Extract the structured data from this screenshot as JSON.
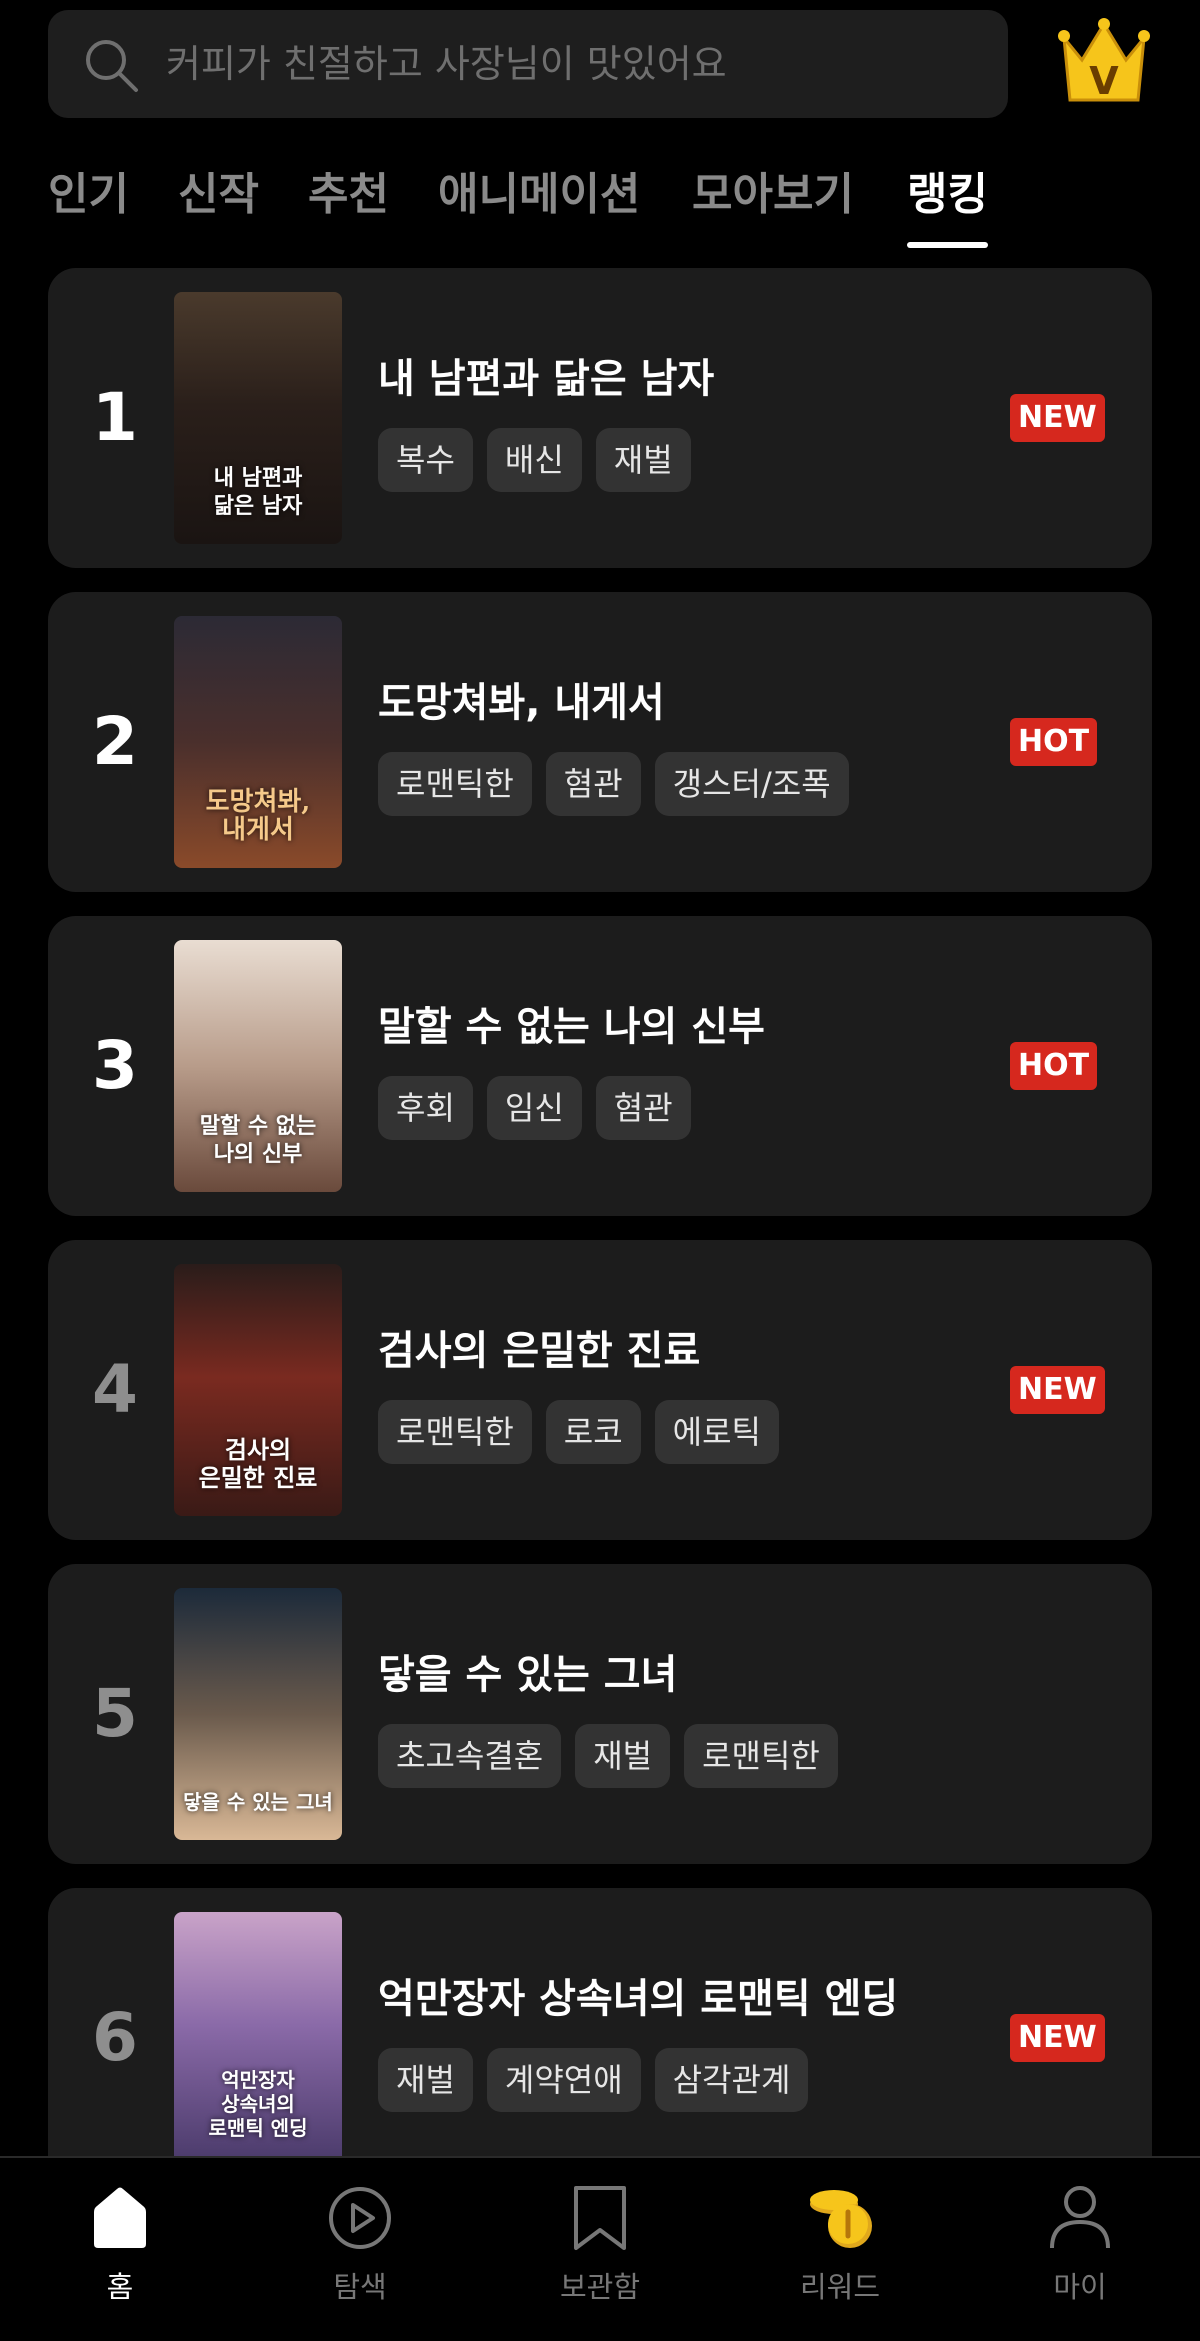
{
  "search": {
    "placeholder": "커피가 친절하고 사장님이 맛있어요",
    "crown_letter": "V"
  },
  "tabs": [
    {
      "label": "인기"
    },
    {
      "label": "신작"
    },
    {
      "label": "추천"
    },
    {
      "label": "애니메이션"
    },
    {
      "label": "모아보기"
    },
    {
      "label": "랭킹",
      "active": true
    }
  ],
  "ranking": [
    {
      "rank": "1",
      "title": "내 남편과 닮은 남자",
      "tags": [
        "복수",
        "배신",
        "재벌"
      ],
      "badge": "NEW",
      "cover_text": "내 남편과\n닮은 남자"
    },
    {
      "rank": "2",
      "title": "도망쳐봐, 내게서",
      "tags": [
        "로맨틱한",
        "혐관",
        "갱스터/조폭"
      ],
      "badge": "HOT",
      "cover_text": "도망쳐봐,\n내게서"
    },
    {
      "rank": "3",
      "title": "말할 수 없는 나의 신부",
      "tags": [
        "후회",
        "임신",
        "혐관"
      ],
      "badge": "HOT",
      "cover_text": "말할 수 없는\n나의 신부"
    },
    {
      "rank": "4",
      "title": "검사의 은밀한 진료",
      "tags": [
        "로맨틱한",
        "로코",
        "에로틱"
      ],
      "badge": "NEW",
      "cover_text": "검사의\n은밀한 진료"
    },
    {
      "rank": "5",
      "title": "닿을 수 있는 그녀",
      "tags": [
        "초고속결혼",
        "재벌",
        "로맨틱한"
      ],
      "badge": "",
      "cover_text": "닿을 수 있는 그녀"
    },
    {
      "rank": "6",
      "title": "억만장자 상속녀의 로맨틱 엔딩",
      "tags": [
        "재벌",
        "계약연애",
        "삼각관계"
      ],
      "badge": "NEW",
      "cover_text": "억만장자\n상속녀의\n로맨틱 엔딩"
    }
  ],
  "nav": [
    {
      "label": "홈",
      "icon": "home-icon",
      "active": true
    },
    {
      "label": "탐색",
      "icon": "play-circle-icon"
    },
    {
      "label": "보관함",
      "icon": "bookmark-icon"
    },
    {
      "label": "리워드",
      "icon": "coins-icon"
    },
    {
      "label": "마이",
      "icon": "person-icon"
    }
  ],
  "colors": {
    "badge": "#d6281e",
    "card": "#1c1c1c",
    "tag": "#333333",
    "accent_gold": "#f6c51b"
  }
}
